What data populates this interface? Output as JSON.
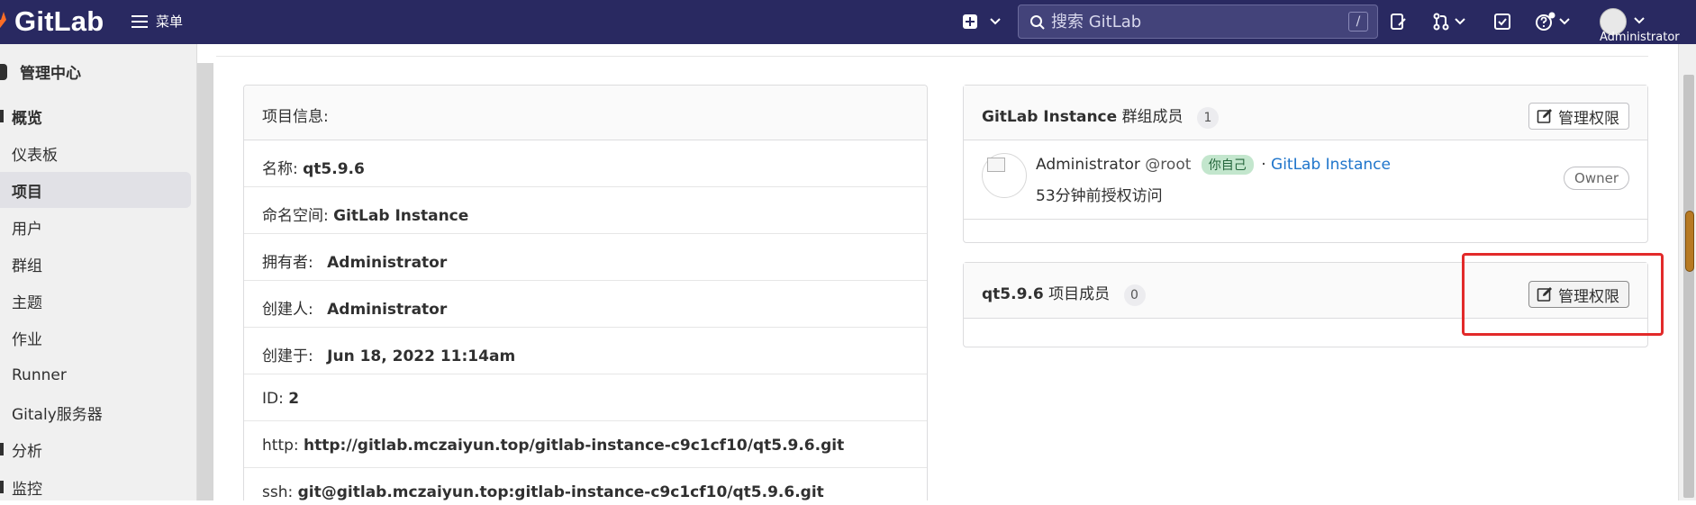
{
  "navbar": {
    "logo_text": "GitLab",
    "menu_label": "菜单",
    "search_placeholder": "搜索 GitLab",
    "search_shortcut": "/",
    "user_label": "Administrator"
  },
  "sidebar": {
    "header": "管理中心",
    "items": [
      {
        "label": "概览"
      },
      {
        "label": "仪表板"
      },
      {
        "label": "项目"
      },
      {
        "label": "用户"
      },
      {
        "label": "群组"
      },
      {
        "label": "主题"
      },
      {
        "label": "作业"
      },
      {
        "label": "Runner"
      },
      {
        "label": "Gitaly服务器"
      },
      {
        "label": "分析"
      },
      {
        "label": "监控"
      }
    ]
  },
  "project_info": {
    "header": "项目信息:",
    "rows": [
      {
        "label": "名称:",
        "value": "qt5.9.6"
      },
      {
        "label": "命名空间:",
        "value": "GitLab Instance"
      },
      {
        "label": "拥有者:",
        "value": "Administrator"
      },
      {
        "label": "创建人:",
        "value": "Administrator"
      },
      {
        "label": "创建于:",
        "value": "Jun 18, 2022 11:14am"
      },
      {
        "label": "ID:",
        "value": "2"
      },
      {
        "label": "http:",
        "value": "http://gitlab.mczaiyun.top/gitlab-instance-c9c1cf10/qt5.9.6.git"
      },
      {
        "label": "ssh:",
        "value": "git@gitlab.mczaiyun.top:gitlab-instance-c9c1cf10/qt5.9.6.git"
      }
    ]
  },
  "group_members": {
    "group_name": "GitLab Instance",
    "title_suffix": "群组成员",
    "count": "1",
    "manage_button": "管理权限",
    "member": {
      "name": "Administrator",
      "handle": "@root",
      "you_badge": "你自己",
      "separator": "·",
      "group_link": "GitLab Instance",
      "access_time": "53分钟前授权访问",
      "role": "Owner"
    }
  },
  "project_members": {
    "project_name": "qt5.9.6",
    "title_suffix": "项目成员",
    "count": "0",
    "manage_button": "管理权限"
  },
  "colors": {
    "navbar": "#292961",
    "highlight": "#e22a2a",
    "link": "#1f75cb"
  }
}
